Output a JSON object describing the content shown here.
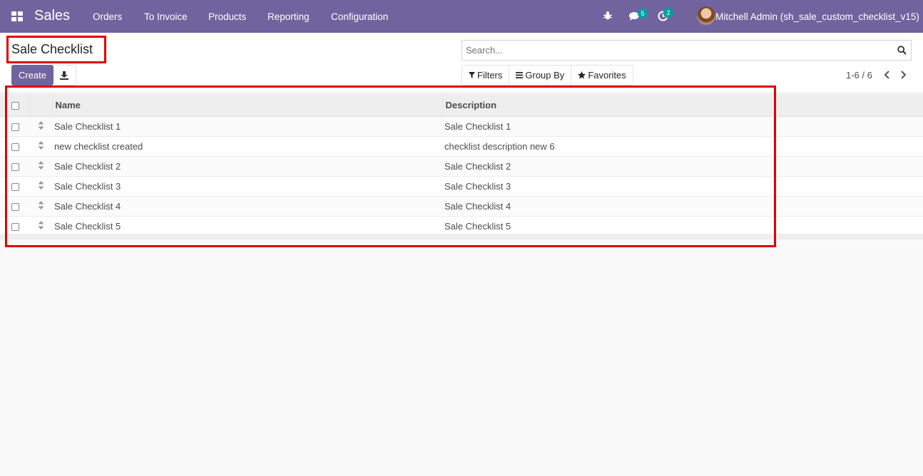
{
  "navbar": {
    "app_name": "Sales",
    "menu": [
      "Orders",
      "To Invoice",
      "Products",
      "Reporting",
      "Configuration"
    ],
    "messages_count": "5",
    "activities_count": "2",
    "user_name": "Mitchell Admin (sh_sale_custom_checklist_v15)",
    "icons": [
      "apps-grid-icon",
      "bug-icon",
      "chat-icon",
      "clock-icon"
    ]
  },
  "control_panel": {
    "title": "Sale Checklist",
    "create_label": "Create",
    "search_placeholder": "Search...",
    "filters_label": "Filters",
    "groupby_label": "Group By",
    "favorites_label": "Favorites",
    "pager": "1-6 / 6"
  },
  "table": {
    "headers": {
      "name": "Name",
      "description": "Description"
    },
    "rows": [
      {
        "name": "Sale Checklist 1",
        "description": "Sale Checklist 1"
      },
      {
        "name": "new checklist created",
        "description": "checklist description new 6"
      },
      {
        "name": "Sale Checklist 2",
        "description": "Sale Checklist 2"
      },
      {
        "name": "Sale Checklist 3",
        "description": "Sale Checklist 3"
      },
      {
        "name": "Sale Checklist 4",
        "description": "Sale Checklist 4"
      },
      {
        "name": "Sale Checklist 5",
        "description": "Sale Checklist 5"
      }
    ]
  },
  "colors": {
    "brand": "#71639e",
    "badge": "#00a09d",
    "highlight": "#e00000"
  }
}
